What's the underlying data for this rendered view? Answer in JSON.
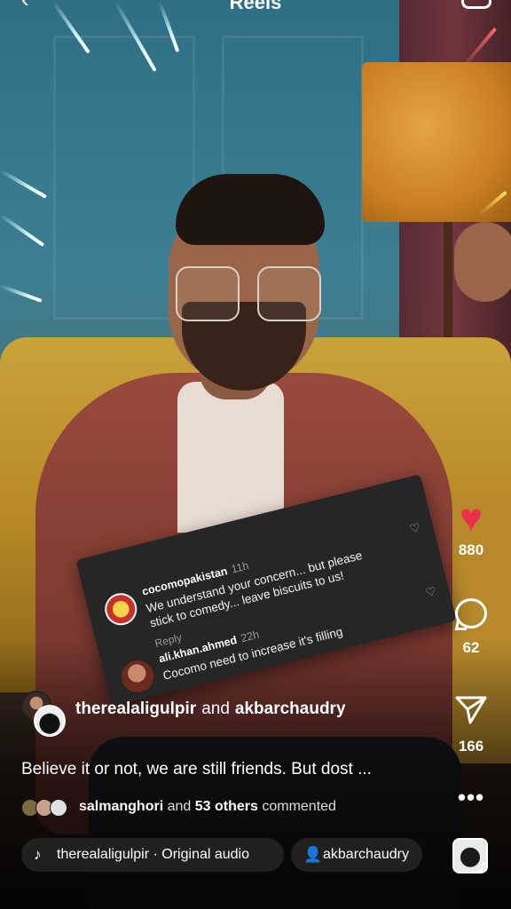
{
  "header": {
    "title": "Reels",
    "back_icon": "chevron-left-icon",
    "camera_icon": "camera-icon"
  },
  "comment_card": {
    "comments": [
      {
        "username": "cocomopakistan",
        "time": "11h",
        "text_line1": "We understand your concern... but please",
        "text_line2": "stick to comedy... leave biscuits to us!",
        "reply_label": "Reply"
      },
      {
        "username": "ali.khan.ahmed",
        "time": "22h",
        "text_line1": "Cocomo need to increase it's filling"
      }
    ]
  },
  "actions": {
    "likes": "880",
    "comments": "62",
    "shares": "166",
    "more_label": "•••"
  },
  "post": {
    "author_primary": "therealaligulpir",
    "author_joiner": "and",
    "author_secondary": "akbarchaudry",
    "caption": "Believe it or not, we are still friends. But dost ...",
    "commenters_name": "salmanghori",
    "commenters_and": "and",
    "commenters_others": "53 others",
    "commenters_suffix": "commented"
  },
  "audio": {
    "label": "therealaligulpir · Original audio",
    "tagged_user": "akbarchaudry"
  },
  "colors": {
    "like_red": "#ef2e4e",
    "card_bg": "#262626"
  }
}
